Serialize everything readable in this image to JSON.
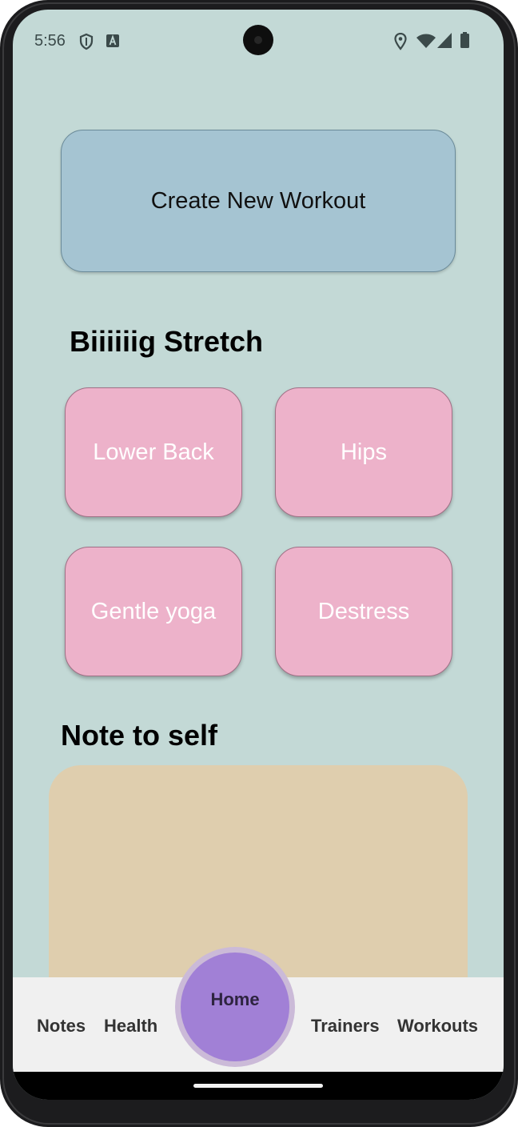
{
  "status_bar": {
    "time": "5:56",
    "left_icons": [
      "shield-icon",
      "text-a-icon"
    ],
    "right_icons": [
      "location-icon",
      "wifi-icon",
      "signal-icon",
      "battery-icon"
    ]
  },
  "create_button": {
    "label": "Create New Workout"
  },
  "stretch_section": {
    "title": "Biiiiiig Stretch",
    "tiles": [
      {
        "label": "Lower Back"
      },
      {
        "label": "Hips"
      },
      {
        "label": "Gentle yoga"
      },
      {
        "label": "Destress"
      }
    ]
  },
  "notes_section": {
    "title": "Note to self",
    "text": ""
  },
  "bottom_nav": {
    "items": [
      {
        "label": "Notes"
      },
      {
        "label": "Health"
      },
      {
        "label": "Home"
      },
      {
        "label": "Trainers"
      },
      {
        "label": "Workouts"
      }
    ],
    "active": "Home"
  },
  "colors": {
    "background": "#c3d9d6",
    "create_button": "#a5c4d2",
    "tile": "#edb2ca",
    "note_card": "#dfceae",
    "nav_bar": "#f0f0f0",
    "home_button": "#a180d6"
  }
}
